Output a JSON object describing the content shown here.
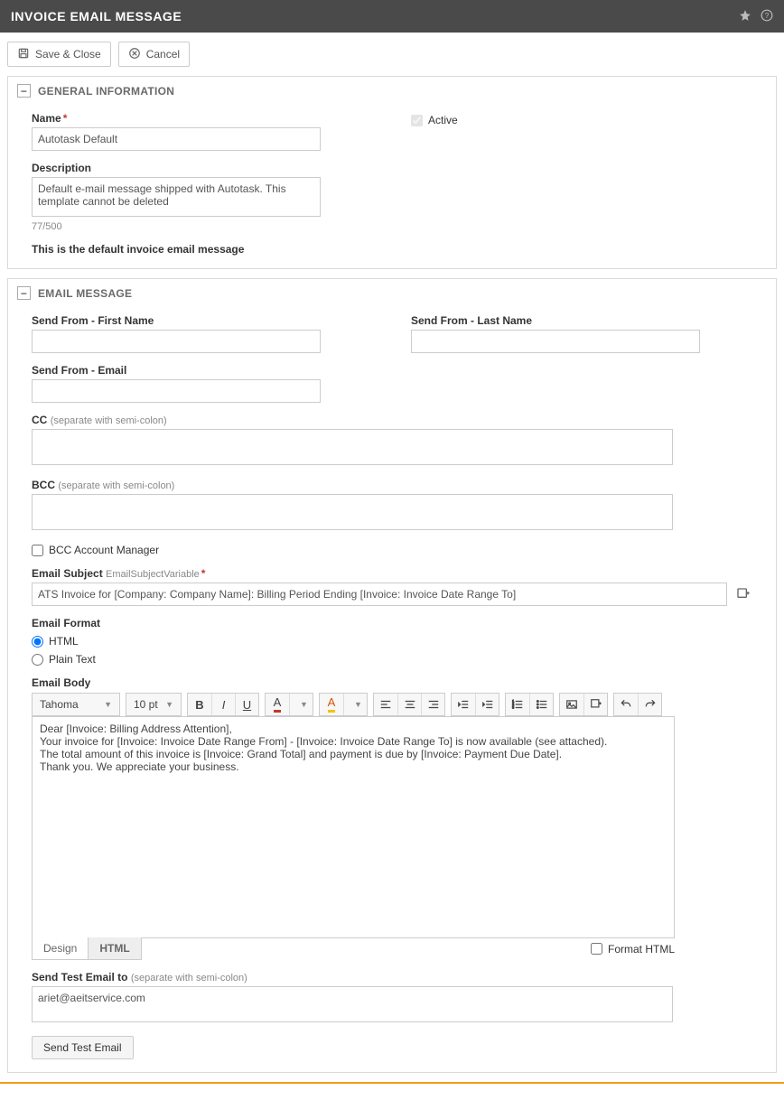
{
  "title": "INVOICE EMAIL MESSAGE",
  "toolbar": {
    "save_close": "Save & Close",
    "cancel": "Cancel"
  },
  "sections": {
    "general": {
      "title": "GENERAL INFORMATION",
      "name_label": "Name",
      "name_value": "Autotask Default",
      "description_label": "Description",
      "description_value": "Default e-mail message shipped with Autotask. This template cannot be deleted",
      "counter": "77/500",
      "default_note": "This is the default invoice email message",
      "active_label": "Active",
      "active_checked": true
    },
    "email": {
      "title": "EMAIL MESSAGE",
      "send_from_first_label": "Send From - First Name",
      "send_from_first_value": "",
      "send_from_last_label": "Send From - Last Name",
      "send_from_last_value": "",
      "send_from_email_label": "Send From - Email",
      "send_from_email_value": "",
      "cc_label": "CC",
      "cc_hint": "(separate with semi-colon)",
      "cc_value": "",
      "bcc_label": "BCC",
      "bcc_hint": "(separate with semi-colon)",
      "bcc_value": "",
      "bcc_account_mgr_label": "BCC Account Manager",
      "bcc_account_mgr_checked": false,
      "subject_label": "Email Subject",
      "subject_hint": "EmailSubjectVariable",
      "subject_value": "ATS Invoice for [Company: Company Name]: Billing Period Ending [Invoice: Invoice Date Range To]",
      "format_label": "Email Format",
      "format_html": "HTML",
      "format_plain": "Plain Text",
      "format_selected": "html",
      "body_label": "Email Body",
      "font_family": "Tahoma",
      "font_size": "10 pt",
      "body_value": "Dear [Invoice: Billing Address Attention],\nYour invoice for [Invoice: Invoice Date Range From] - [Invoice: Invoice Date Range To] is now available (see attached).\nThe total amount of this invoice is [Invoice: Grand Total] and payment is due by [Invoice: Payment Due Date].\nThank you. We appreciate your business.",
      "tabs": {
        "design": "Design",
        "html": "HTML",
        "active": "html"
      },
      "format_html_checkbox_label": "Format HTML",
      "format_html_checkbox_checked": false,
      "send_test_label": "Send Test Email to",
      "send_test_hint": "(separate with semi-colon)",
      "send_test_value": "ariet@aeitservice.com",
      "send_test_btn": "Send Test Email"
    }
  }
}
